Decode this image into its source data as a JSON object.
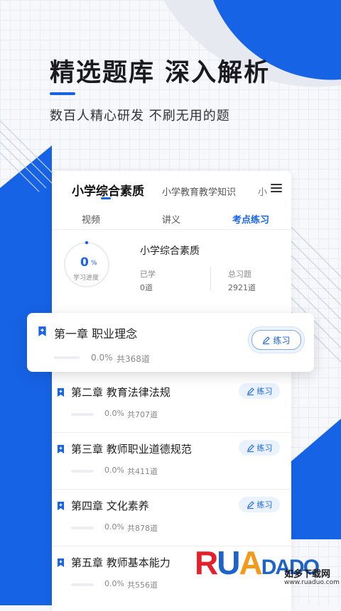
{
  "hero": {
    "title": "精选题库  深入解析",
    "subtitle": "数百人精心研发  不刷无用的题"
  },
  "topic_tabs": [
    {
      "label": "小学综合素质",
      "active": true
    },
    {
      "label": "小学教育教学知识",
      "active": false
    },
    {
      "label": "小",
      "active": false
    }
  ],
  "sub_tabs": [
    {
      "label": "视频",
      "active": false
    },
    {
      "label": "讲义",
      "active": false
    },
    {
      "label": "考点练习",
      "active": true
    }
  ],
  "progress": {
    "value": "0",
    "unit": "%",
    "label": "学习进度",
    "fraction": 0
  },
  "subject": {
    "name": "小学综合素质",
    "learned_label": "已学",
    "learned_value": "0道",
    "total_label": "总习题",
    "total_value": "2921道"
  },
  "chapters": [
    {
      "title": "第一章 职业理念",
      "percent": "0.0%",
      "total": "共368道",
      "action": "练习"
    },
    {
      "title": "第二章 教育法律法规",
      "percent": "0.0%",
      "total": "共707道",
      "action": "练习"
    },
    {
      "title": "第三章 教师职业道德规范",
      "percent": "0.0%",
      "total": "共411道",
      "action": "练习"
    },
    {
      "title": "第四章 文化素养",
      "percent": "0.0%",
      "total": "共878道",
      "action": "练习"
    },
    {
      "title": "第五章 教师基本能力",
      "percent": "0.0%",
      "total": "共556道",
      "action": "练习"
    }
  ],
  "watermark": {
    "logo_r": "R",
    "logo_u": "U",
    "logo_a": "A",
    "logo_rest": "DADO",
    "tagline": "如多下载网",
    "url": "www.ruaduo.com"
  },
  "colors": {
    "accent": "#1763e6",
    "practice_bg": "#eaf2fd",
    "background": "#f7f8fb"
  },
  "icons": {
    "chapter": "bookmark-plus-icon",
    "practice": "pencil-icon",
    "menu": "hamburger-menu-icon"
  }
}
